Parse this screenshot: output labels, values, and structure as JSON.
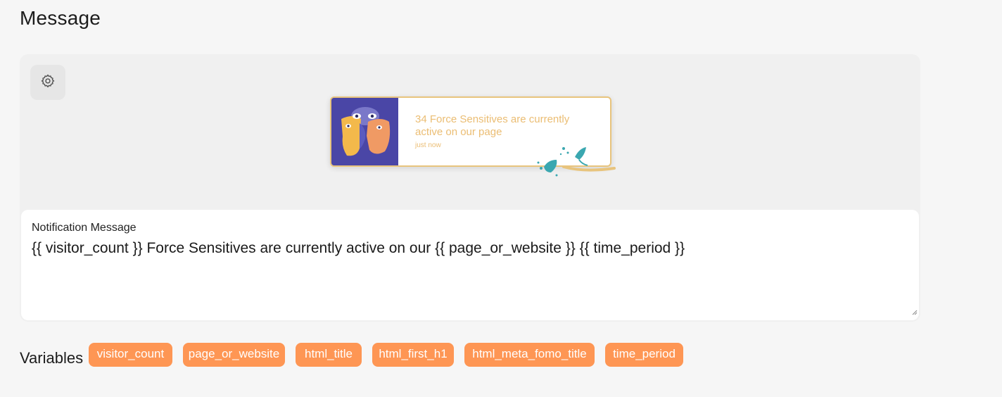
{
  "page": {
    "title": "Message"
  },
  "preview": {
    "settings_icon": "gear-icon",
    "notification": {
      "message": "34 Force Sensitives are currently active on our page",
      "time": "just now",
      "image_icon": "faces-illustration",
      "border_color": "#e8c47d",
      "text_color": "#ebbd73"
    }
  },
  "message_field": {
    "label": "Notification Message",
    "value": "{{ visitor_count }} Force Sensitives are currently active on our {{ page_or_website }} {{ time_period }}"
  },
  "variables": {
    "label": "Variables",
    "chip_color": "#fe9654",
    "items": [
      "visitor_count",
      "page_or_website",
      "html_title",
      "html_first_h1",
      "html_meta_fomo_title",
      "time_period"
    ]
  }
}
